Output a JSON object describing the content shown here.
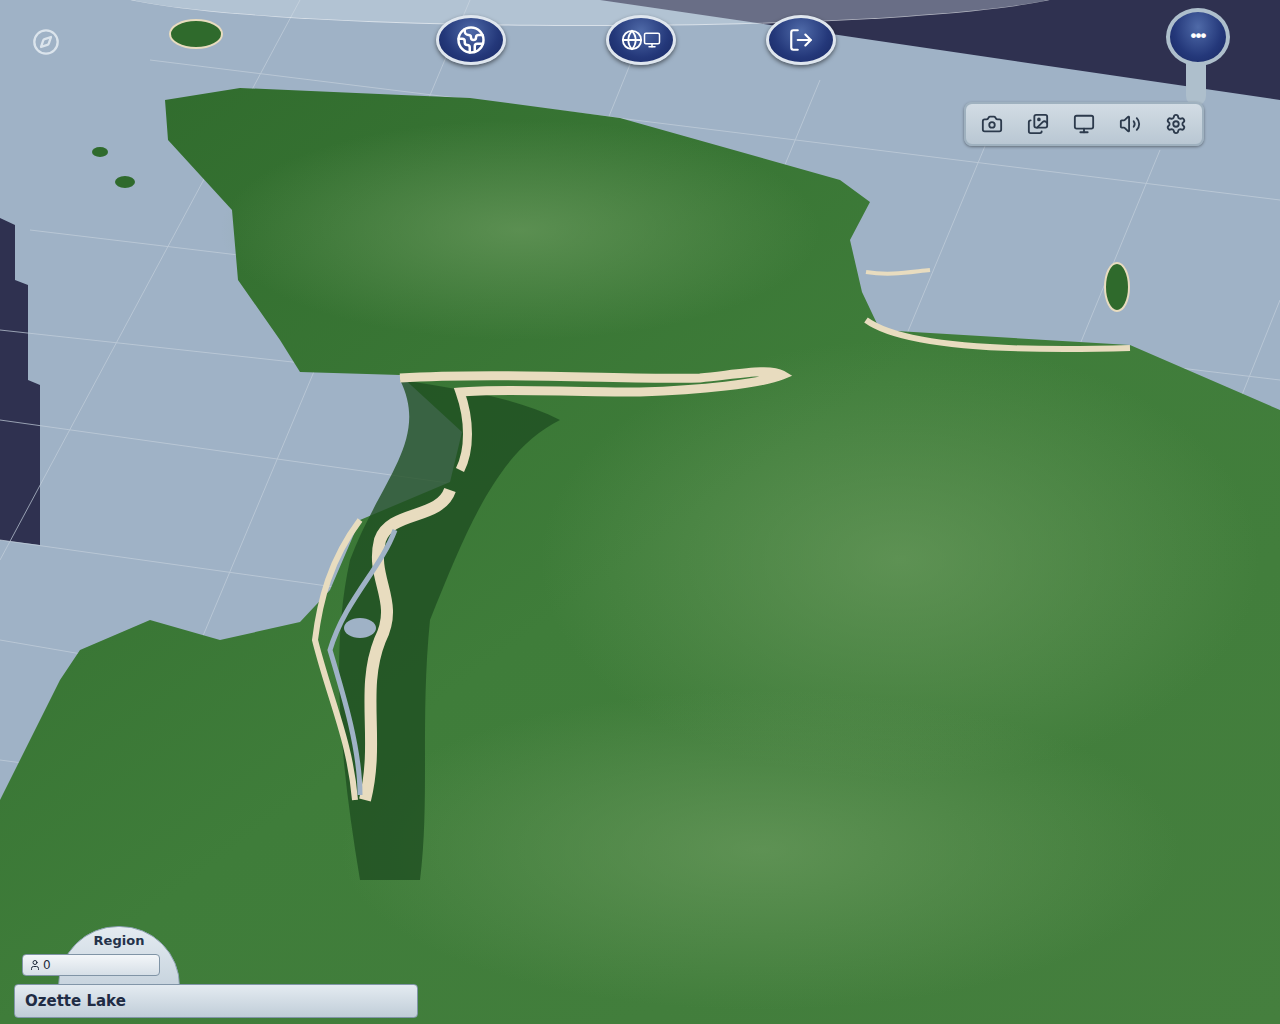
{
  "menu_button": {
    "label": "•••",
    "expanded": true
  },
  "region_panel": {
    "title": "Region",
    "population": "0",
    "name": "Ozette Lake"
  }
}
